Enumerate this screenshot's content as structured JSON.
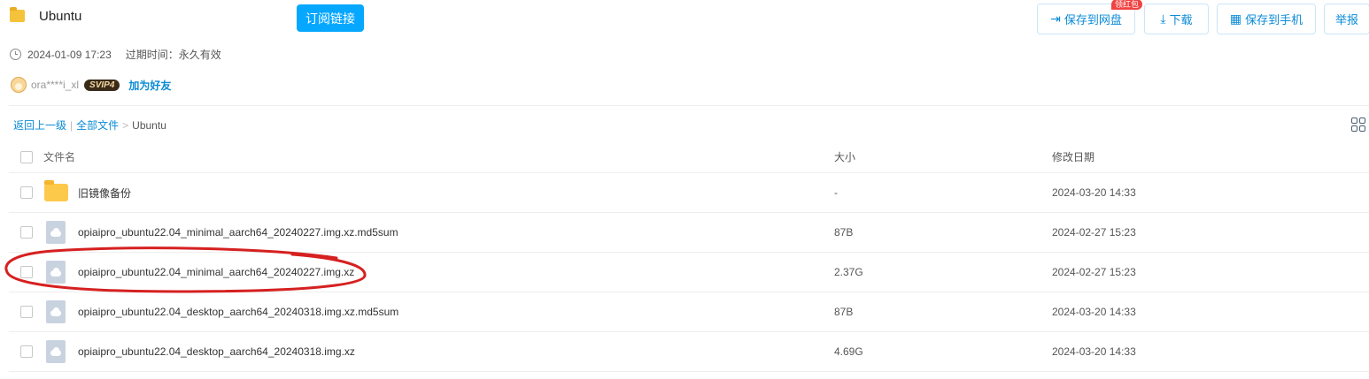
{
  "header": {
    "title": "Ubuntu",
    "subscribe_label": "订阅链接",
    "actions": {
      "save_label": "保存到网盘",
      "save_badge": "领红包",
      "download_label": "下载",
      "phone_label": "保存到手机",
      "report_label": "举报"
    }
  },
  "meta": {
    "created": "2024-01-09 17:23",
    "expiry": "过期时间：永久有效"
  },
  "user": {
    "name": "ora****i_xl",
    "vip": "SVIP4",
    "add_friend": "加为好友"
  },
  "breadcrumb": {
    "back": "返回上一级",
    "sep": "|",
    "root": "全部文件",
    "arrow": ">",
    "current": "Ubuntu"
  },
  "table": {
    "columns": {
      "name": "文件名",
      "size": "大小",
      "date": "修改日期"
    },
    "rows": [
      {
        "name": "旧镜像备份",
        "size": "-",
        "date": "2024-03-20 14:33",
        "type": "folder"
      },
      {
        "name": "opiaipro_ubuntu22.04_minimal_aarch64_20240227.img.xz.md5sum",
        "size": "87B",
        "date": "2024-02-27 15:23",
        "type": "file"
      },
      {
        "name": "opiaipro_ubuntu22.04_minimal_aarch64_20240227.img.xz",
        "size": "2.37G",
        "date": "2024-02-27 15:23",
        "type": "file"
      },
      {
        "name": "opiaipro_ubuntu22.04_desktop_aarch64_20240318.img.xz.md5sum",
        "size": "87B",
        "date": "2024-03-20 14:33",
        "type": "file"
      },
      {
        "name": "opiaipro_ubuntu22.04_desktop_aarch64_20240318.img.xz",
        "size": "4.69G",
        "date": "2024-03-20 14:33",
        "type": "file"
      }
    ]
  },
  "colors": {
    "accent": "#06a7ff",
    "link": "#0a8bd6",
    "annotation": "#d62020"
  }
}
